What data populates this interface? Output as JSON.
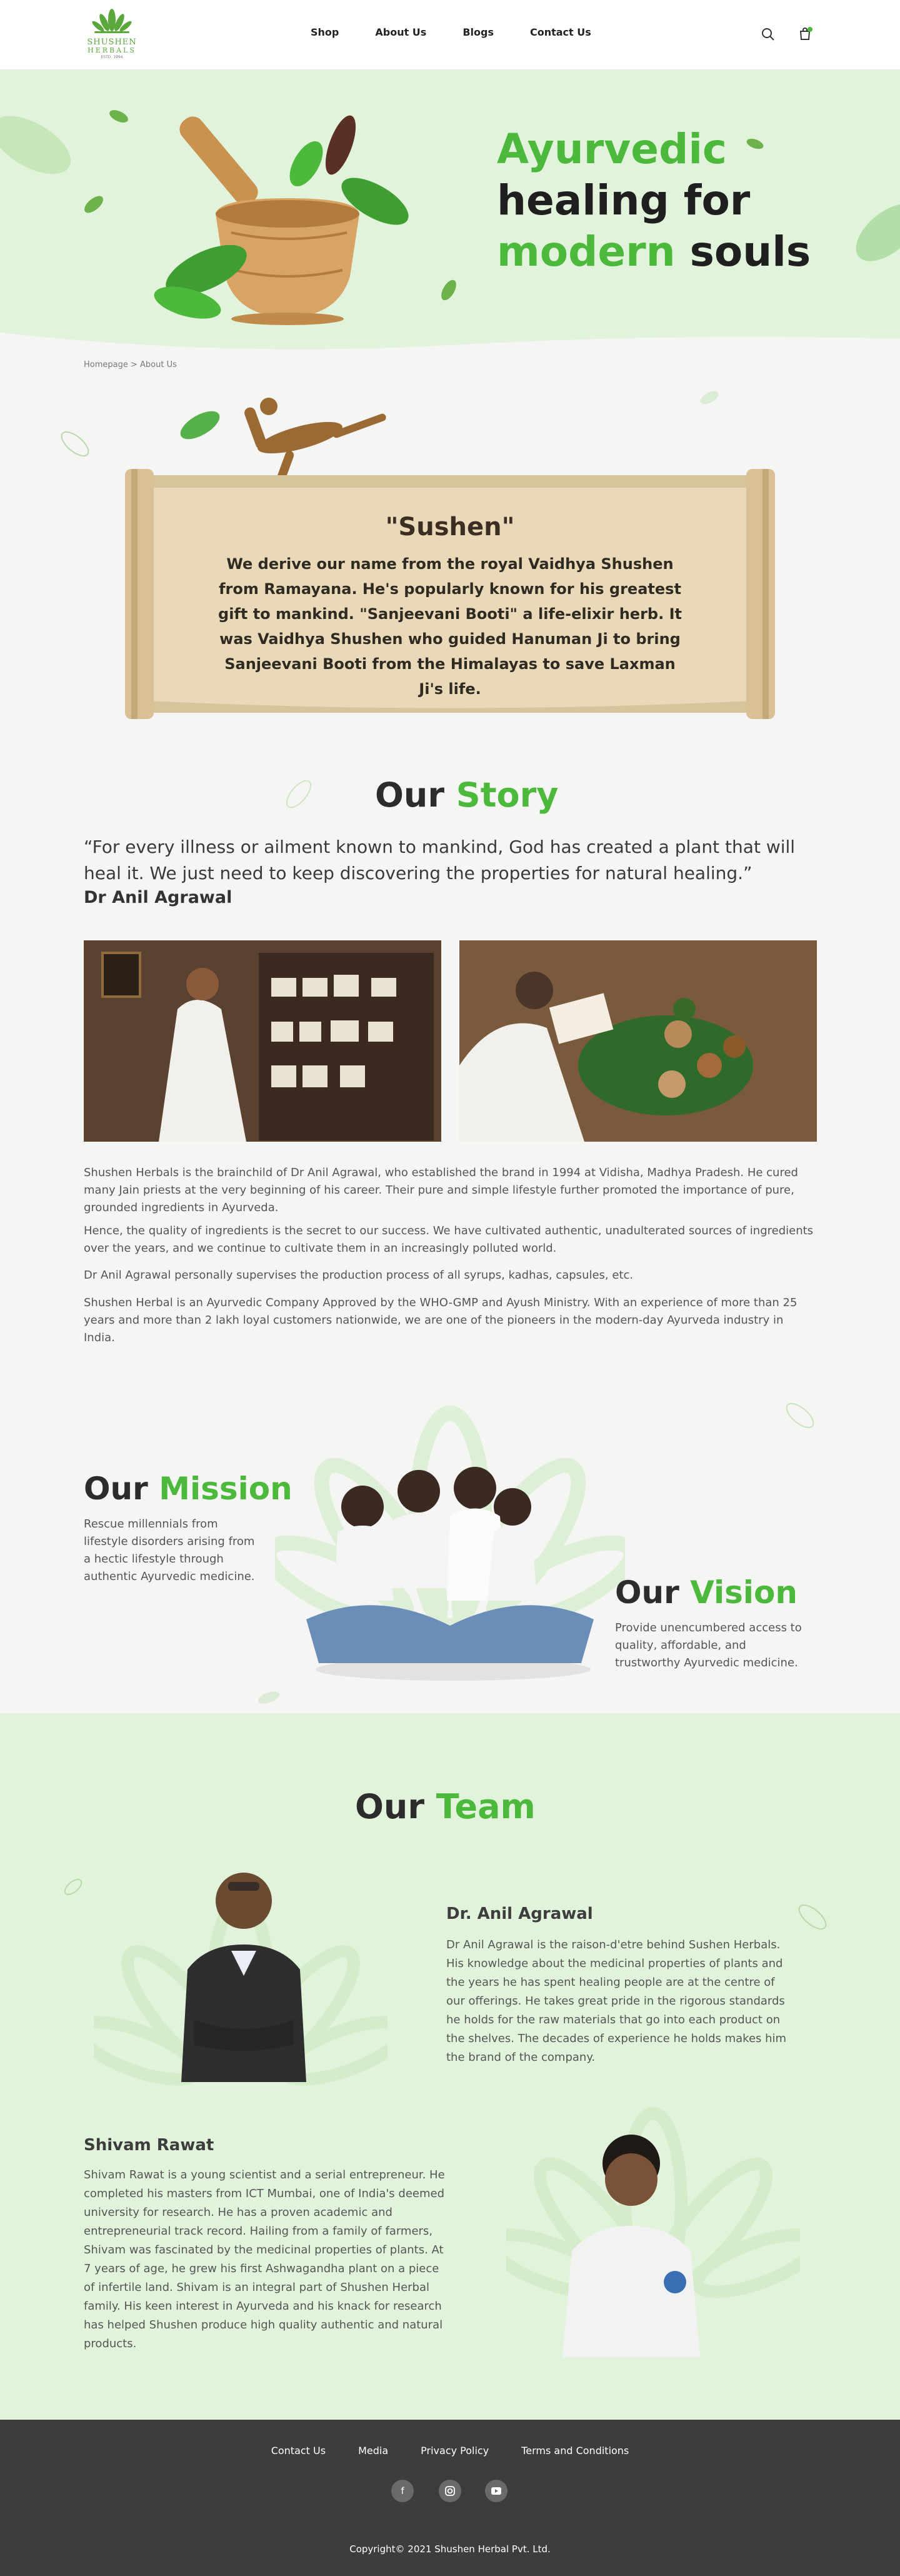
{
  "header": {
    "logo_name": "SHUSHEN",
    "logo_sub": "HERBALS",
    "logo_est": "ESTD. 1994",
    "nav": [
      "Shop",
      "About Us",
      "Blogs",
      "Contact Us"
    ]
  },
  "hero": {
    "line1": "Ayurvedic",
    "line2": "healing for",
    "line3_green": "modern",
    "line3_dark": "souls"
  },
  "breadcrumb": "Homepage > About Us",
  "scroll": {
    "title": "\"Sushen\"",
    "text": "We derive our name from the royal Vaidhya Shushen from Ramayana. He's popularly known for his greatest gift to mankind. \"Sanjeevani Booti\" a life-elixir herb. It was Vaidhya Shushen who guided Hanuman Ji to bring Sanjeevani Booti from the Himalayas to save Laxman Ji's life."
  },
  "story": {
    "h_dark": "Our",
    "h_green": "Story",
    "quote": "“For every illness or ailment known to mankind, God has created a plant  that will heal it. We just need to keep discovering the properties for natural healing.”",
    "author": "Dr Anil Agrawal",
    "paragraphs": [
      "Shushen Herbals is the brainchild of Dr Anil Agrawal, who established the brand in 1994 at Vidisha, Madhya Pradesh. He cured many Jain priests at the very beginning of his career. Their pure and simple lifestyle further promoted the importance of pure, grounded ingredients in Ayurveda.",
      "Hence, the quality of ingredients is the secret to our success. We have cultivated authentic, unadulterated sources of ingredients over the years, and we continue to cultivate them in an increasingly polluted world.",
      "Dr Anil Agrawal personally supervises the production process of all syrups, kadhas, capsules, etc.",
      "Shushen Herbal is an Ayurvedic Company Approved by the WHO-GMP and Ayush Ministry. With an experience of more than 25 years and more than 2 lakh loyal customers nationwide, we are one of the pioneers in the modern-day Ayurveda industry in India."
    ]
  },
  "mission": {
    "h_dark": "Our",
    "h_green": "Mission",
    "text": "Rescue millennials from lifestyle disorders arising from a hectic lifestyle through authentic Ayurvedic medicine."
  },
  "vision": {
    "h_dark": "Our",
    "h_green": "Vision",
    "text": "Provide unencumbered access to quality, affordable, and trustworthy Ayurvedic medicine."
  },
  "team": {
    "h_dark": "Our",
    "h_green": "Team",
    "members": [
      {
        "name": "Dr. Anil Agrawal",
        "bio": "Dr Anil Agrawal is the raison-d'etre behind Sushen Herbals. His knowledge about the medicinal properties of plants and the years he has spent healing people are at the centre of our offerings. He takes great pride in the rigorous standards he holds for the raw materials that go into each product on the shelves. The decades of experience he holds makes him the brand of the company."
      },
      {
        "name": "Shivam Rawat",
        "bio": "Shivam Rawat is a young scientist and a serial entrepreneur. He completed his masters from ICT Mumbai, one of India's deemed university for research. He has a proven academic and entrepreneurial track record. Hailing from a family of farmers, Shivam was fascinated by the medicinal properties of plants. At 7 years of age, he grew his first Ashwagandha plant on a piece of infertile land. Shivam is an integral part of Shushen Herbal family. His keen interest in Ayurveda and his knack for research has helped Shushen produce high quality authentic and natural products."
      }
    ]
  },
  "footer": {
    "links": [
      "Contact Us",
      "Media",
      "Privacy Policy",
      "Terms and Conditions"
    ],
    "social": [
      "facebook-icon",
      "instagram-icon",
      "youtube-icon"
    ],
    "copyright": "Copyright© 2021 Shushen Herbal Pvt. Ltd."
  },
  "colors": {
    "accent": "#4cb93c",
    "hero_bg": "#e2f3dc",
    "footer_bg": "#3d3d3d"
  }
}
